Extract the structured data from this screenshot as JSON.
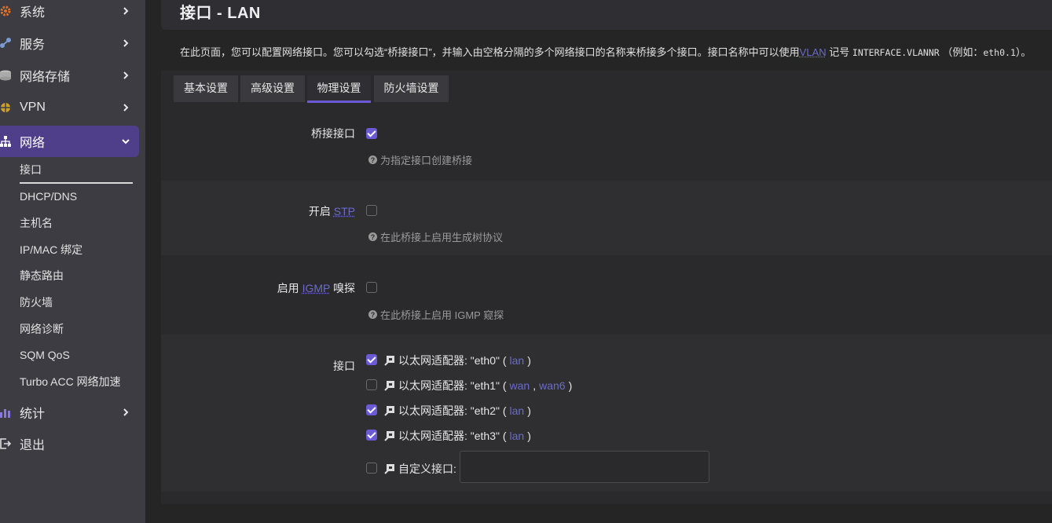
{
  "sidebar": {
    "items": [
      {
        "label": "系统",
        "icon": "gear-icon"
      },
      {
        "label": "服务",
        "icon": "share-icon"
      },
      {
        "label": "网络存储",
        "icon": "database-icon"
      },
      {
        "label": "VPN",
        "icon": "globe-icon"
      },
      {
        "label": "网络",
        "icon": "sitemap-icon"
      },
      {
        "label": "统计",
        "icon": "bar-chart-icon"
      },
      {
        "label": "退出",
        "icon": "logout-icon"
      }
    ],
    "sub_items": [
      "接口",
      "DHCP/DNS",
      "主机名",
      "IP/MAC 绑定",
      "静态路由",
      "防火墙",
      "网络诊断",
      "SQM QoS",
      "Turbo ACC 网络加速"
    ]
  },
  "page": {
    "title": "接口 - LAN",
    "desc_before": "在此页面，您可以配置网络接口。您可以勾选“桥接接口”，并输入由空格分隔的多个网络接口的名称来桥接多个接口。接口名称中可以使用",
    "desc_link": "VLAN",
    "desc_mid": "记号",
    "desc_mono": "INTERFACE.VLANNR",
    "desc_after": "（例如：",
    "desc_example": "eth0.1",
    "desc_end": "）。"
  },
  "tabs": [
    "基本设置",
    "高级设置",
    "物理设置",
    "防火墙设置"
  ],
  "form": {
    "bridge": {
      "label": "桥接接口",
      "checked": true,
      "hint": "为指定接口创建桥接"
    },
    "stp": {
      "label_prefix": "开启",
      "label_link": "STP",
      "checked": false,
      "hint": "在此桥接上启用生成树协议"
    },
    "igmp": {
      "label_prefix": "启用",
      "label_link": "IGMP",
      "label_suffix": "嗅探",
      "checked": false,
      "hint": "在此桥接上启用 IGMP 窥探"
    },
    "iface": {
      "label": "接口",
      "options": [
        {
          "text": "以太网适配器: \"eth0\" (",
          "tags": [
            "lan"
          ],
          "checked": true
        },
        {
          "text": "以太网适配器: \"eth1\" (",
          "tags": [
            "wan",
            "wan6"
          ],
          "checked": false
        },
        {
          "text": "以太网适配器: \"eth2\" (",
          "tags": [
            "lan"
          ],
          "checked": true
        },
        {
          "text": "以太网适配器: \"eth3\" (",
          "tags": [
            "lan"
          ],
          "checked": true
        }
      ],
      "custom_label": "自定义接口:",
      "custom_value": ""
    }
  },
  "colors": {
    "accent": "#6b5ad6",
    "link": "#6b6bc9",
    "sidebar_active": "#4f3e8a"
  }
}
